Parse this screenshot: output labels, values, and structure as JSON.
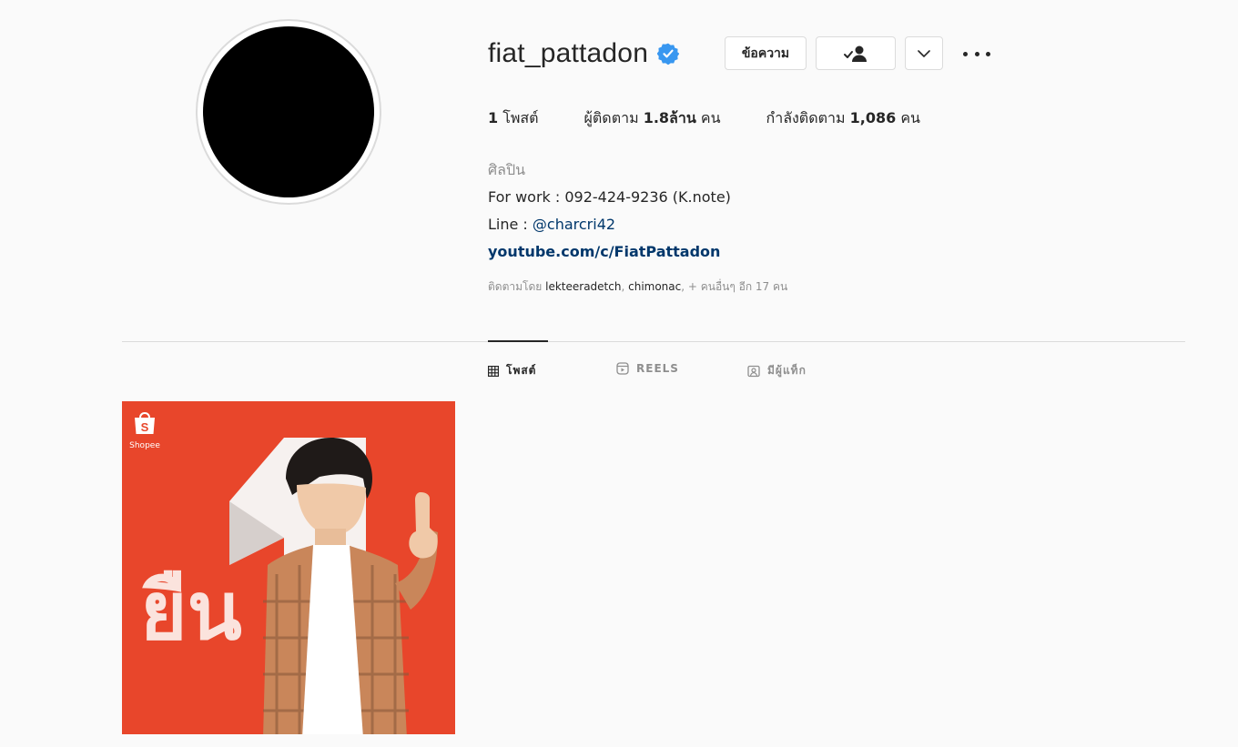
{
  "profile": {
    "username": "fiat_pattadon",
    "verified": true,
    "buttons": {
      "message_label": "ข้อความ",
      "following_icon": "person-check-icon",
      "dropdown_icon": "chevron-down-icon",
      "more_icon": "more-horizontal-icon"
    },
    "stats": {
      "posts_count": "1",
      "posts_label": "โพสต์",
      "followers_label": "ผู้ติดตาม",
      "followers_count": "1.8ล้าน",
      "followers_unit": "คน",
      "following_label": "กำลังติดตาม",
      "following_count": "1,086",
      "following_unit": "คน"
    },
    "bio": {
      "category": "ศิลปิน",
      "line1": "For work : 092-424-9236 (K.note)",
      "line2_prefix": "Line : ",
      "line2_mention": "@charcri42",
      "website": "youtube.com/c/FiatPattadon"
    },
    "followed_by": {
      "prefix": "ติดตามโดย ",
      "user1": "lekteeradetch",
      "sep": ", ",
      "user2": "chimonac",
      "suffix": ", + คนอื่นๆ อีก 17 คน"
    }
  },
  "tabs": [
    {
      "label": "โพสต์",
      "icon": "grid-icon",
      "active": true
    },
    {
      "label": "REELS",
      "icon": "reels-icon",
      "active": false
    },
    {
      "label": "มีผู้แท็ก",
      "icon": "tagged-icon",
      "active": false
    }
  ],
  "posts": [
    {
      "brand": "Shopee",
      "text": "ยืน",
      "colors": {
        "background": "#e8462b"
      }
    }
  ],
  "colors": {
    "background": "#fafafa",
    "text": "#262626",
    "muted": "#8e8e8e",
    "link": "#00376b",
    "verified": "#3897f0"
  }
}
